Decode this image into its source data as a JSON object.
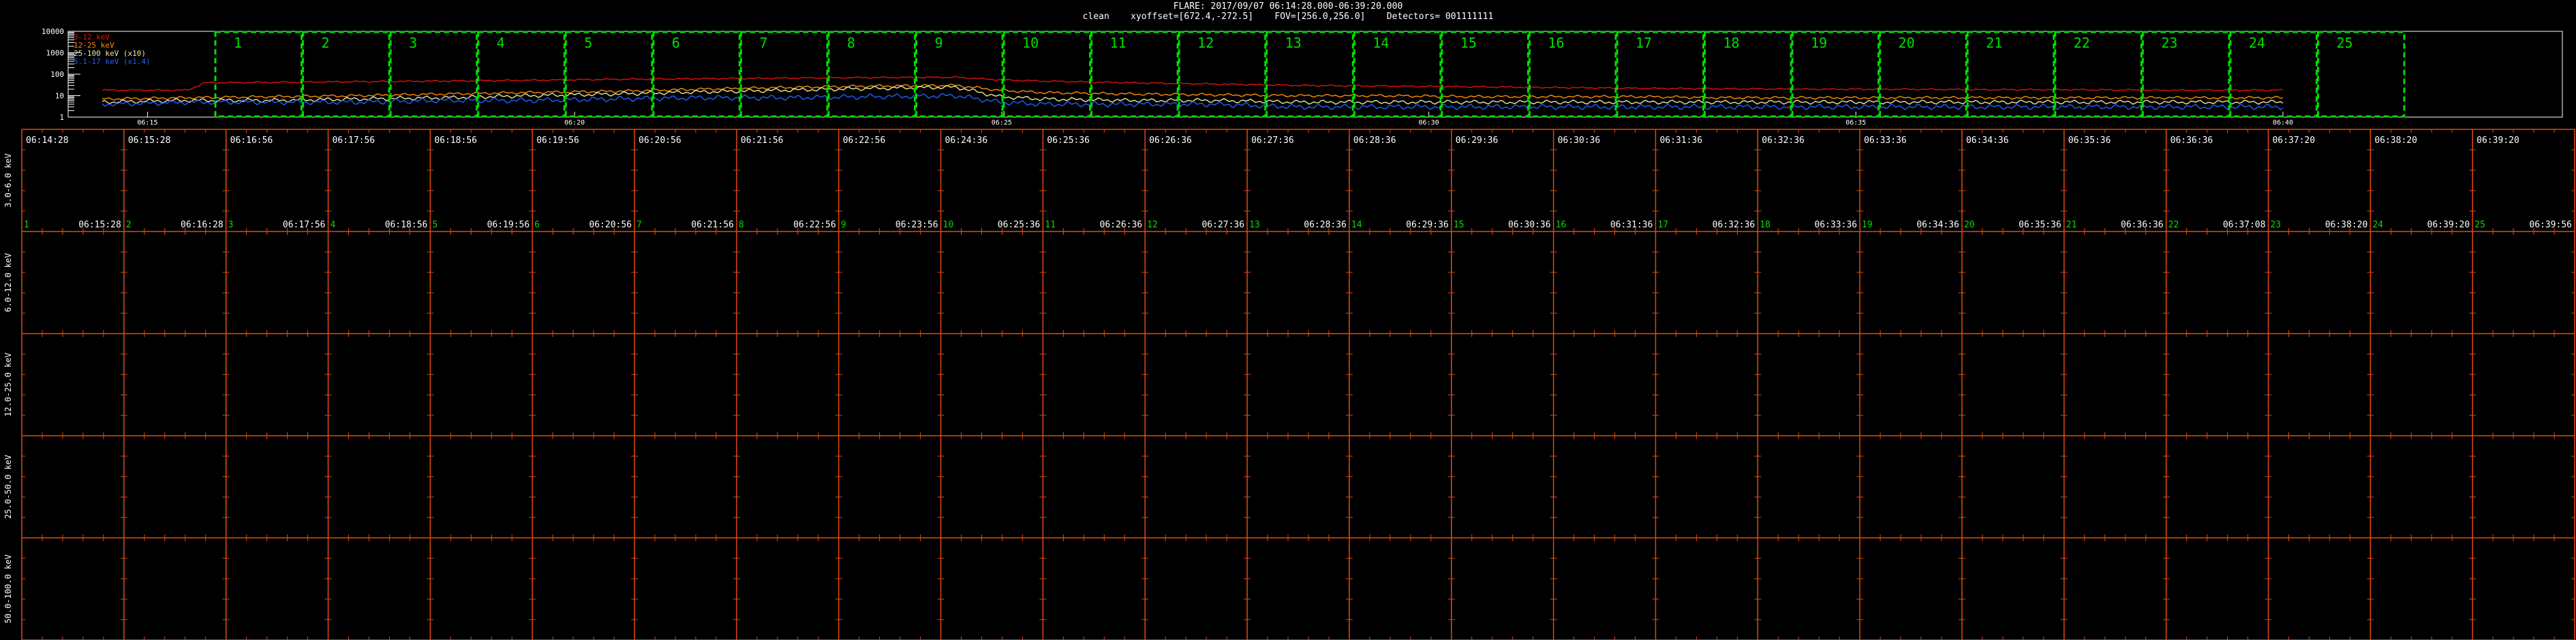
{
  "header": {
    "line1": "FLARE: 2017/09/07 06:14:28.000-06:39:20.000",
    "line2": "clean    xyoffset=[672.4,-272.5]    FOV=[256.0,256.0]    Detectors= 001111111"
  },
  "colors": {
    "red": "#e01010",
    "orange": "#ff8c00",
    "yellow": "#e8e8a0",
    "blue": "#2060ff",
    "green_box": "#00dd00",
    "grid_orange": "#e04a10",
    "white": "#ffffff"
  },
  "chart_data": [
    {
      "type": "line",
      "panel": "lightcurve",
      "yscale": "log",
      "ylim": [
        1,
        10000
      ],
      "y_ticks": [
        "10000",
        "1000",
        "100",
        "10",
        "1"
      ],
      "xlim_minutes": [
        0,
        25.53
      ],
      "x_ticks": [
        {
          "label": "06:15",
          "t": 0.53
        },
        {
          "label": "06:20",
          "t": 5.53
        },
        {
          "label": "06:25",
          "t": 10.53
        },
        {
          "label": "06:30",
          "t": 15.53
        },
        {
          "label": "06:35",
          "t": 20.53
        },
        {
          "label": "06:40",
          "t": 25.53
        }
      ],
      "series": [
        {
          "name": "3-12 keV",
          "color": "red",
          "t": [
            0,
            1,
            1.2,
            2,
            3,
            4,
            5,
            6,
            7,
            8,
            9,
            10,
            10.5,
            11,
            12,
            13,
            14,
            15,
            16,
            17,
            18,
            19,
            20,
            21,
            22,
            23,
            24,
            25
          ],
          "y": [
            18,
            18,
            40,
            42,
            45,
            48,
            52,
            58,
            62,
            66,
            70,
            72,
            55,
            48,
            40,
            35,
            30,
            28,
            26,
            24,
            22,
            21,
            20,
            20,
            19,
            19,
            18,
            18
          ]
        },
        {
          "name": "12-25 keV",
          "color": "orange",
          "t": [
            0,
            1,
            2,
            3,
            4,
            5,
            6,
            7,
            8,
            9,
            10,
            10.5,
            11,
            12,
            13,
            14,
            15,
            16,
            17,
            18,
            19,
            20,
            21,
            22,
            23,
            24,
            25
          ],
          "y": [
            7,
            8,
            9,
            10,
            12,
            14,
            16,
            20,
            24,
            28,
            30,
            18,
            14,
            12,
            11,
            10,
            10,
            9,
            9,
            9,
            8,
            8,
            8,
            8,
            8,
            8,
            8
          ]
        },
        {
          "name": "25-100 keV (x10)",
          "color": "yellow",
          "t": [
            0,
            1,
            2,
            3,
            4,
            5,
            6,
            7,
            8,
            9,
            10,
            10.5,
            11,
            12,
            13,
            14,
            15,
            16,
            17,
            18,
            19,
            20,
            21,
            22,
            23,
            24,
            25
          ],
          "y": [
            5,
            6,
            6,
            7,
            8,
            10,
            12,
            15,
            18,
            22,
            25,
            9,
            7,
            6,
            6,
            5,
            5,
            5,
            5,
            5,
            5,
            5,
            5,
            5,
            5,
            5,
            5
          ]
        },
        {
          "name": "5.1-17 keV (x1.4)",
          "color": "blue",
          "t": [
            0,
            1,
            2,
            3,
            4,
            5,
            6,
            7,
            8,
            9,
            10,
            10.5,
            11,
            12,
            13,
            14,
            15,
            16,
            17,
            18,
            19,
            20,
            21,
            22,
            23,
            24,
            25
          ],
          "y": [
            4,
            5,
            5,
            5,
            6,
            6,
            7,
            8,
            8,
            9,
            10,
            5,
            4,
            4,
            4,
            3,
            3,
            3,
            3,
            3,
            3,
            3,
            3,
            3,
            3,
            3,
            3
          ]
        }
      ],
      "intervals": [
        "1",
        "2",
        "3",
        "4",
        "5",
        "6",
        "7",
        "8",
        "9",
        "10",
        "11",
        "12",
        "13",
        "14",
        "15",
        "16",
        "17",
        "18",
        "19",
        "20",
        "21",
        "22",
        "23",
        "24",
        "25"
      ]
    },
    {
      "type": "table",
      "panel": "image-grid",
      "rows": 5,
      "columns": 25,
      "row_labels": [
        "3.0-6.0 keV",
        "6.0-12.0 keV",
        "12.0-25.0 keV",
        "25.0-50.0 keV",
        "50.0-100.0 keV"
      ],
      "start_times": [
        "06:14:28",
        "06:15:28",
        "06:16:56",
        "06:17:56",
        "06:18:56",
        "06:19:56",
        "06:20:56",
        "06:21:56",
        "06:22:56",
        "06:24:36",
        "06:25:36",
        "06:26:36",
        "06:27:36",
        "06:28:36",
        "06:29:36",
        "06:30:36",
        "06:31:36",
        "06:32:36",
        "06:33:36",
        "06:34:36",
        "06:35:36",
        "06:36:36",
        "06:37:20",
        "06:38:20",
        "06:39:20"
      ],
      "end_times": [
        "06:15:28",
        "06:16:28",
        "06:17:56",
        "06:18:56",
        "06:19:56",
        "06:20:56",
        "06:21:56",
        "06:22:56",
        "06:23:56",
        "06:25:36",
        "06:26:36",
        "06:27:36",
        "06:28:36",
        "06:29:36",
        "06:30:36",
        "06:31:36",
        "06:32:36",
        "06:33:36",
        "06:34:36",
        "06:35:36",
        "06:36:36",
        "06:37:08",
        "06:38:20",
        "06:39:20",
        "06:39:56"
      ],
      "interval_numbers": [
        "1",
        "2",
        "3",
        "4",
        "5",
        "6",
        "7",
        "8",
        "9",
        "10",
        "11",
        "12",
        "13",
        "14",
        "15",
        "16",
        "17",
        "18",
        "19",
        "20",
        "21",
        "22",
        "23",
        "24",
        "25"
      ]
    }
  ]
}
